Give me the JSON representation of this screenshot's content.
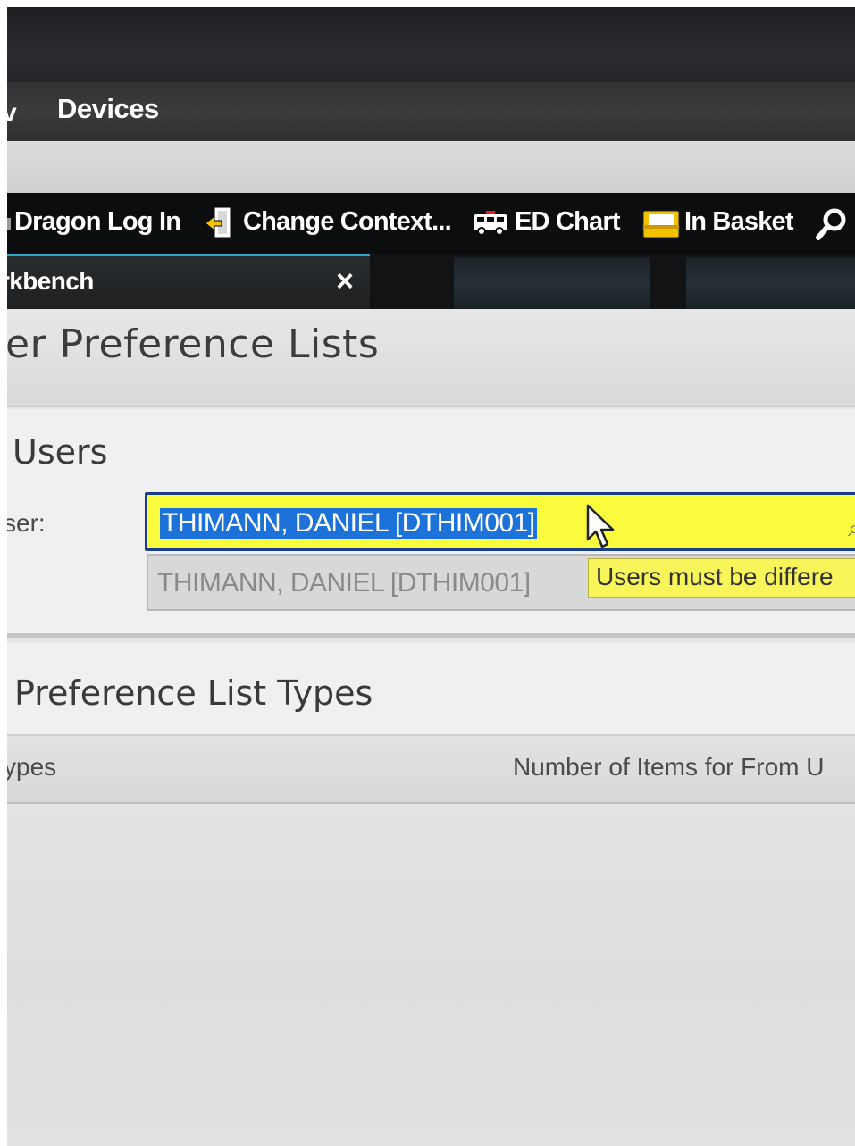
{
  "menubar": {
    "fragment_left": "v",
    "devices": "Devices"
  },
  "toolbar": {
    "dragon_login": "Dragon Log In",
    "change_context": "Change Context...",
    "ed_chart": "ED Chart",
    "in_basket": "In Basket"
  },
  "tab": {
    "label": "rkbench",
    "close": "×"
  },
  "page": {
    "title": "er Preference Lists"
  },
  "users": {
    "heading": "Users",
    "from_label": "ser:",
    "to_label": ":",
    "from_value": "THIMANN, DANIEL [DTHIM001]",
    "to_value": "THIMANN, DANIEL [DTHIM001]",
    "error": "Users must be differe"
  },
  "types": {
    "heading": "Preference List Types",
    "col_types": "ypes",
    "col_count": "Number of Items for From U"
  },
  "colors": {
    "from_field_bg": "#fbfb3e",
    "selection": "#1c72d8",
    "tab_accent": "#2aa7c9",
    "toolbar_bg": "#0c0d0e"
  }
}
